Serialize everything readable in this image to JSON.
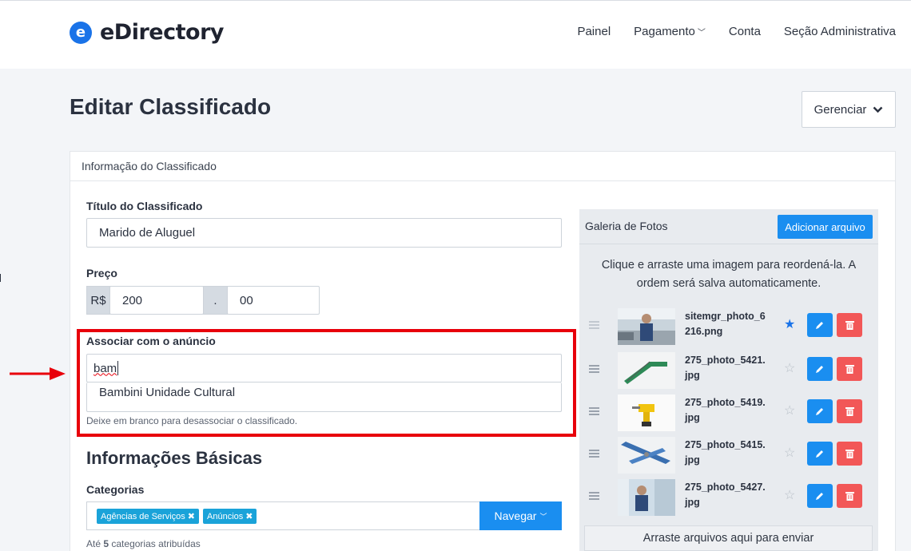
{
  "brand": {
    "logo_letter": "e",
    "name": "eDirectory",
    "accent": "#1a73e8"
  },
  "nav": {
    "items": [
      {
        "label": "Painel"
      },
      {
        "label": "Pagamento",
        "has_dropdown": true
      },
      {
        "label": "Conta"
      },
      {
        "label": "Seção Administrativa"
      }
    ]
  },
  "page": {
    "title": "Editar Classificado",
    "manage_label": "Gerenciar"
  },
  "panel": {
    "header": "Informação do Classificado"
  },
  "form": {
    "title_label": "Título do Classificado",
    "title_value": "Marido de Aluguel",
    "price_label": "Preço",
    "currency": "R$",
    "price_whole": "200",
    "price_sep": ".",
    "price_cents": "00",
    "assoc_label": "Associar com o anúncio",
    "assoc_value": "bam",
    "assoc_suggestion": "Bambini Unidade Cultural",
    "assoc_hint": "Deixe em branco para desassociar o classificado.",
    "section_title": "Informações Básicas",
    "categories_label": "Categorias",
    "categories": [
      {
        "label": "Agências de Serviços"
      },
      {
        "label": "Anúncios"
      }
    ],
    "browse_label": "Navegar",
    "cat_hint_prefix": "Até ",
    "cat_hint_count": "5",
    "cat_hint_suffix": " categorias atribuídas"
  },
  "gallery": {
    "title": "Galeria de Fotos",
    "add_label": "Adicionar arquivo",
    "note": "Clique e arraste uma imagem para reordená-la. A ordem será salva automaticamente.",
    "photos": [
      {
        "name": "sitemgr_photo_6216.png",
        "featured": true
      },
      {
        "name": "275_photo_5421.jpg",
        "featured": false
      },
      {
        "name": "275_photo_5419.jpg",
        "featured": false
      },
      {
        "name": "275_photo_5415.jpg",
        "featured": false
      },
      {
        "name": "275_photo_5427.jpg",
        "featured": false
      }
    ],
    "dropzone": "Arraste arquivos aqui para enviar"
  }
}
